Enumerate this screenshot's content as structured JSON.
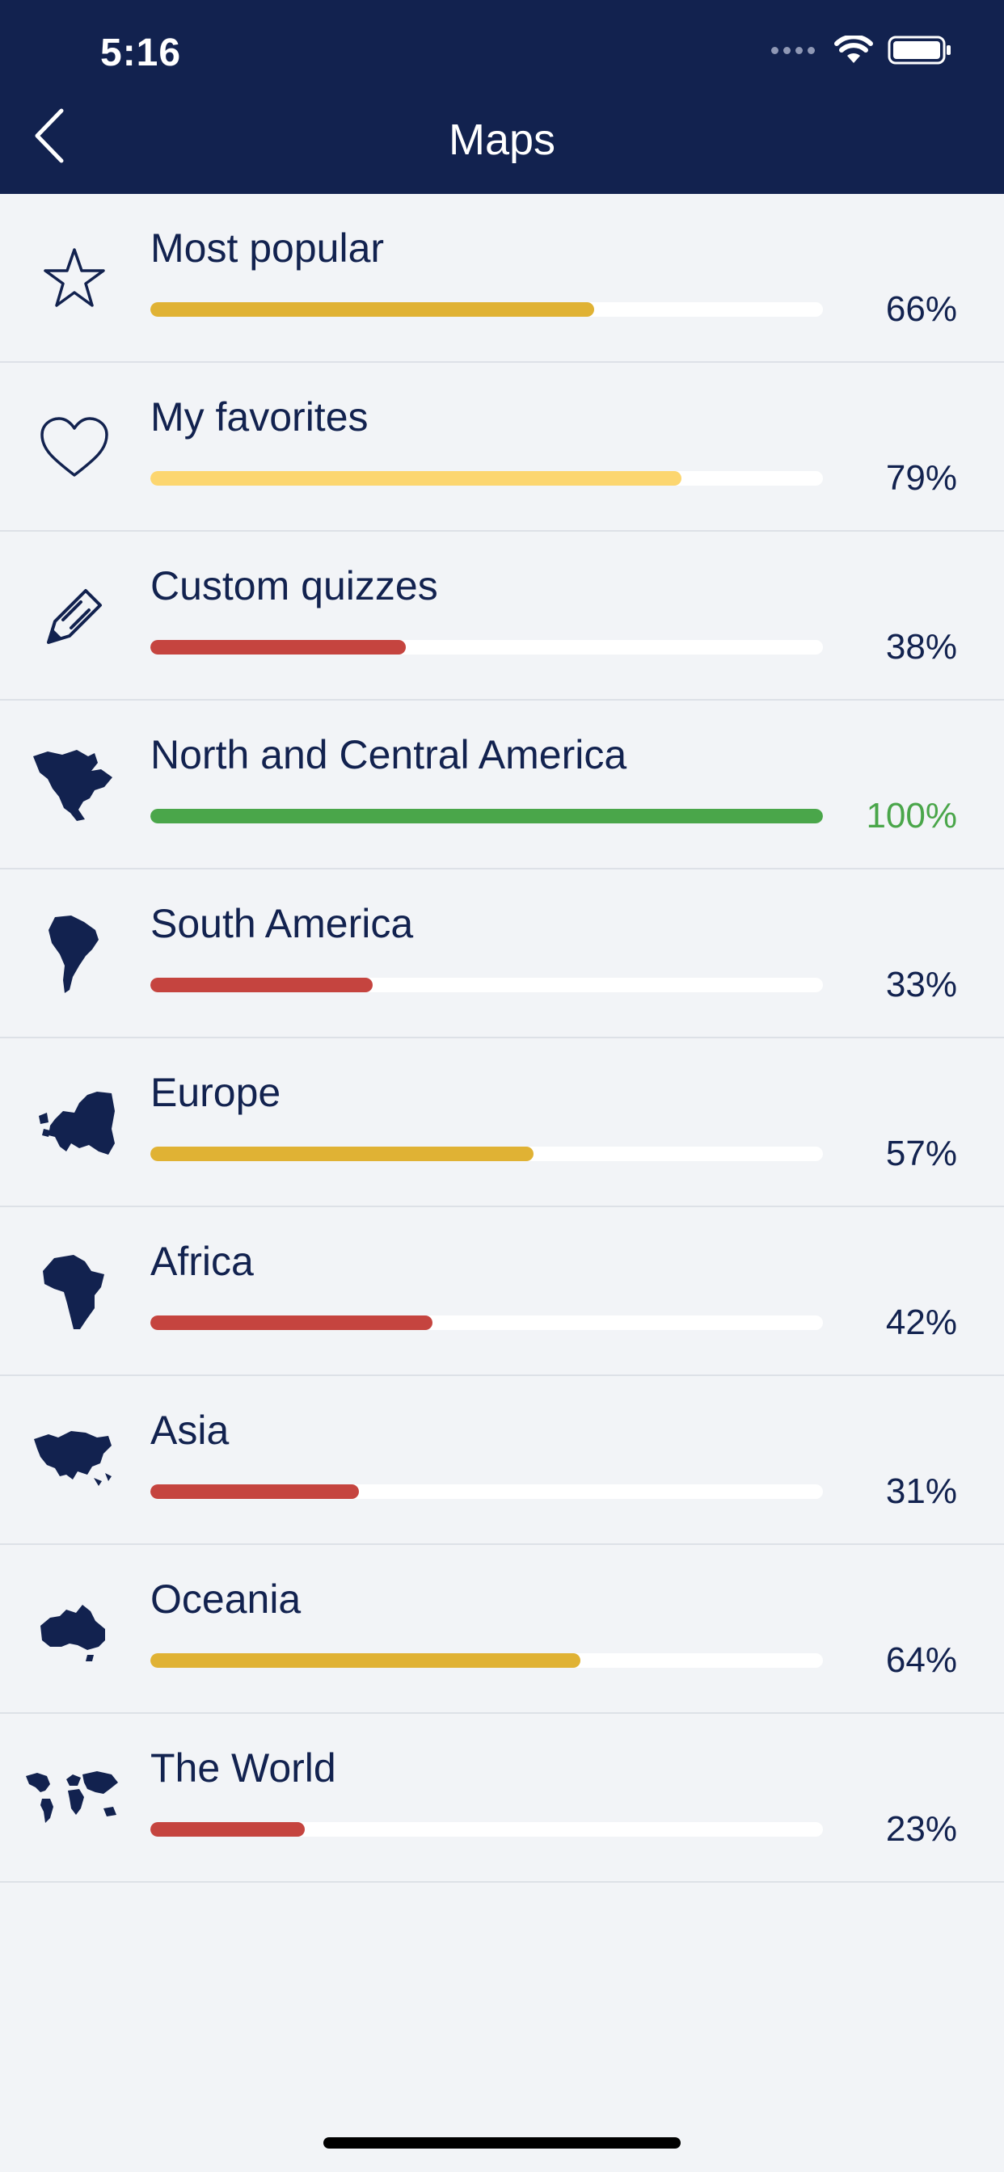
{
  "status_bar": {
    "time": "5:16"
  },
  "header": {
    "title": "Maps"
  },
  "items": [
    {
      "label": "Most popular",
      "percent_text": "66%",
      "progress": 0.66,
      "color": "#e0b234",
      "percent_color": "#12224f",
      "icon": "star-icon"
    },
    {
      "label": "My favorites",
      "percent_text": "79%",
      "progress": 0.79,
      "color": "#fcd670",
      "percent_color": "#12224f",
      "icon": "heart-icon"
    },
    {
      "label": "Custom quizzes",
      "percent_text": "38%",
      "progress": 0.38,
      "color": "#c5443f",
      "percent_color": "#12224f",
      "icon": "pencil-icon"
    },
    {
      "label": "North and Central America",
      "percent_text": "100%",
      "progress": 1.0,
      "color": "#4aa64a",
      "percent_color": "#4aa64a",
      "icon": "north-america-map-icon"
    },
    {
      "label": "South America",
      "percent_text": "33%",
      "progress": 0.33,
      "color": "#c5443f",
      "percent_color": "#12224f",
      "icon": "south-america-map-icon"
    },
    {
      "label": "Europe",
      "percent_text": "57%",
      "progress": 0.57,
      "color": "#e0b234",
      "percent_color": "#12224f",
      "icon": "europe-map-icon"
    },
    {
      "label": "Africa",
      "percent_text": "42%",
      "progress": 0.42,
      "color": "#c5443f",
      "percent_color": "#12224f",
      "icon": "africa-map-icon"
    },
    {
      "label": "Asia",
      "percent_text": "31%",
      "progress": 0.31,
      "color": "#c5443f",
      "percent_color": "#12224f",
      "icon": "asia-map-icon"
    },
    {
      "label": "Oceania",
      "percent_text": "64%",
      "progress": 0.64,
      "color": "#e0b234",
      "percent_color": "#12224f",
      "icon": "oceania-map-icon"
    },
    {
      "label": "The World",
      "percent_text": "23%",
      "progress": 0.23,
      "color": "#c5443f",
      "percent_color": "#12224f",
      "icon": "world-map-icon"
    }
  ],
  "colors": {
    "header": "#12224f",
    "background": "#f2f4f7",
    "text": "#12224f"
  }
}
